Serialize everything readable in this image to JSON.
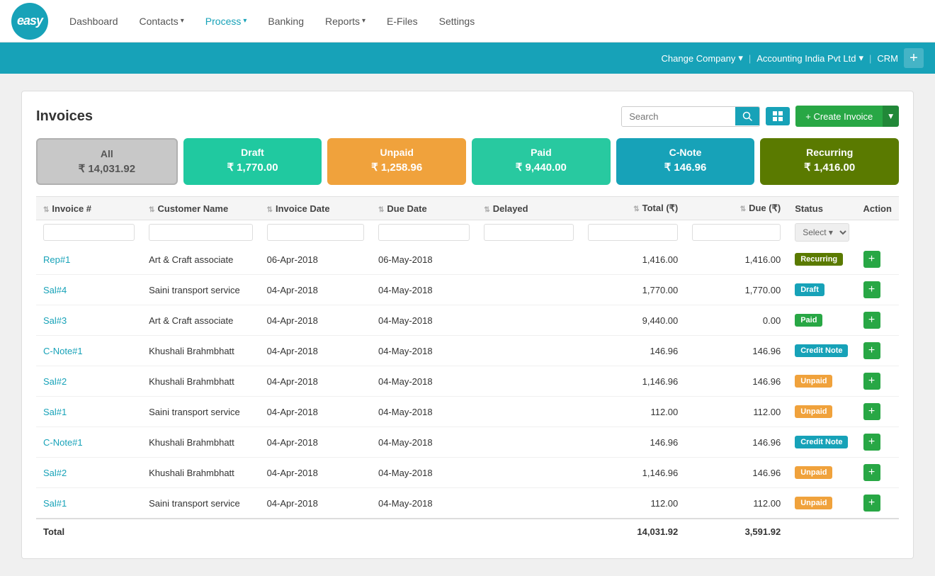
{
  "logo": {
    "text": "easy",
    "alt": "Easy logo"
  },
  "nav": {
    "items": [
      {
        "label": "Dashboard",
        "active": false,
        "hasDropdown": false
      },
      {
        "label": "Contacts",
        "active": false,
        "hasDropdown": true
      },
      {
        "label": "Process",
        "active": true,
        "hasDropdown": true
      },
      {
        "label": "Banking",
        "active": false,
        "hasDropdown": false
      },
      {
        "label": "Reports",
        "active": false,
        "hasDropdown": true
      },
      {
        "label": "E-Files",
        "active": false,
        "hasDropdown": false
      },
      {
        "label": "Settings",
        "active": false,
        "hasDropdown": false
      }
    ]
  },
  "blue_bar": {
    "change_company": "Change Company",
    "company_name": "Accounting India Pvt Ltd",
    "crm": "CRM",
    "plus": "+"
  },
  "page": {
    "title": "Invoices",
    "search_placeholder": "Search",
    "grid_icon": "⊞",
    "create_button": "+ Create Invoice"
  },
  "summary_cards": [
    {
      "key": "all",
      "label": "All",
      "amount": "₹ 14,031.92",
      "class": "all"
    },
    {
      "key": "draft",
      "label": "Draft",
      "amount": "₹ 1,770.00",
      "class": "draft"
    },
    {
      "key": "unpaid",
      "label": "Unpaid",
      "amount": "₹ 1,258.96",
      "class": "unpaid"
    },
    {
      "key": "paid",
      "label": "Paid",
      "amount": "₹ 9,440.00",
      "class": "paid"
    },
    {
      "key": "cnote",
      "label": "C-Note",
      "amount": "₹ 146.96",
      "class": "cnote"
    },
    {
      "key": "recurring",
      "label": "Recurring",
      "amount": "₹ 1,416.00",
      "class": "recurring"
    }
  ],
  "table": {
    "columns": [
      {
        "label": "Invoice #",
        "sortable": true
      },
      {
        "label": "Customer Name",
        "sortable": true
      },
      {
        "label": "Invoice Date",
        "sortable": true
      },
      {
        "label": "Due Date",
        "sortable": true
      },
      {
        "label": "Delayed",
        "sortable": true
      },
      {
        "label": "Total (₹)",
        "sortable": true
      },
      {
        "label": "Due (₹)",
        "sortable": true
      },
      {
        "label": "Status",
        "sortable": false
      },
      {
        "label": "Action",
        "sortable": false
      }
    ],
    "filter_status_placeholder": "Select ▾",
    "rows": [
      {
        "invoice": "Rep#1",
        "customer": "Art & Craft associate",
        "invoice_date": "06-Apr-2018",
        "due_date": "06-May-2018",
        "delayed": "",
        "total": "1,416.00",
        "due": "1,416.00",
        "status": "Recurring",
        "status_class": "badge-recurring"
      },
      {
        "invoice": "Sal#4",
        "customer": "Saini transport service",
        "invoice_date": "04-Apr-2018",
        "due_date": "04-May-2018",
        "delayed": "",
        "total": "1,770.00",
        "due": "1,770.00",
        "status": "Draft",
        "status_class": "badge-draft"
      },
      {
        "invoice": "Sal#3",
        "customer": "Art & Craft associate",
        "invoice_date": "04-Apr-2018",
        "due_date": "04-May-2018",
        "delayed": "",
        "total": "9,440.00",
        "due": "0.00",
        "status": "Paid",
        "status_class": "badge-paid"
      },
      {
        "invoice": "C-Note#1",
        "customer": "Khushali Brahmbhatt",
        "invoice_date": "04-Apr-2018",
        "due_date": "04-May-2018",
        "delayed": "",
        "total": "146.96",
        "due": "146.96",
        "status": "Credit Note",
        "status_class": "badge-credit-note"
      },
      {
        "invoice": "Sal#2",
        "customer": "Khushali Brahmbhatt",
        "invoice_date": "04-Apr-2018",
        "due_date": "04-May-2018",
        "delayed": "",
        "total": "1,146.96",
        "due": "146.96",
        "status": "Unpaid",
        "status_class": "badge-unpaid"
      },
      {
        "invoice": "Sal#1",
        "customer": "Saini transport service",
        "invoice_date": "04-Apr-2018",
        "due_date": "04-May-2018",
        "delayed": "",
        "total": "112.00",
        "due": "112.00",
        "status": "Unpaid",
        "status_class": "badge-unpaid"
      },
      {
        "invoice": "C-Note#1",
        "customer": "Khushali Brahmbhatt",
        "invoice_date": "04-Apr-2018",
        "due_date": "04-May-2018",
        "delayed": "",
        "total": "146.96",
        "due": "146.96",
        "status": "Credit Note",
        "status_class": "badge-credit-note"
      },
      {
        "invoice": "Sal#2",
        "customer": "Khushali Brahmbhatt",
        "invoice_date": "04-Apr-2018",
        "due_date": "04-May-2018",
        "delayed": "",
        "total": "1,146.96",
        "due": "146.96",
        "status": "Unpaid",
        "status_class": "badge-unpaid"
      },
      {
        "invoice": "Sal#1",
        "customer": "Saini transport service",
        "invoice_date": "04-Apr-2018",
        "due_date": "04-May-2018",
        "delayed": "",
        "total": "112.00",
        "due": "112.00",
        "status": "Unpaid",
        "status_class": "badge-unpaid"
      }
    ],
    "total_row": {
      "label": "Total",
      "total": "14,031.92",
      "due": "3,591.92"
    }
  }
}
